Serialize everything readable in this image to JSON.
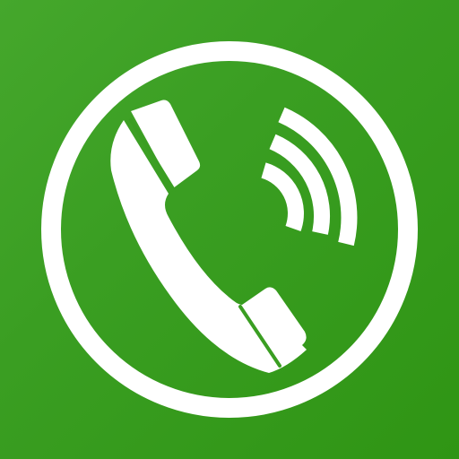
{
  "app_icon": {
    "icon": "phone-call-icon",
    "parts": [
      "ring-outline",
      "phone-handset-icon",
      "signal-waves-icon"
    ]
  },
  "colors": {
    "background_start": "#45a72c",
    "background_end": "#2f9514",
    "foreground": "#ffffff"
  }
}
